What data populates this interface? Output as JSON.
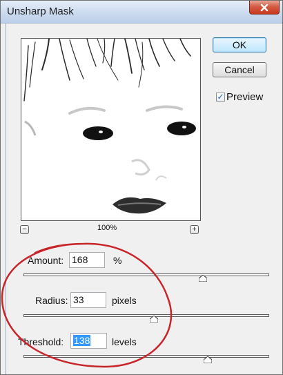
{
  "window": {
    "title": "Unsharp Mask",
    "close_glyph": "X"
  },
  "buttons": {
    "ok_label": "OK",
    "cancel_label": "Cancel"
  },
  "preview": {
    "checkbox_label": "Preview",
    "checked": true,
    "check_glyph": "✓",
    "zoom_level": "100%",
    "zoom_out_glyph": "−",
    "zoom_in_glyph": "+"
  },
  "amount": {
    "label": "Amount:",
    "value": "168",
    "unit": "%",
    "slider_level": 0.73
  },
  "radius": {
    "label": "Radius:",
    "value": "33",
    "unit": "pixels",
    "slider_level": 0.53
  },
  "threshold": {
    "label": "Threshold:",
    "value": "138",
    "unit": "levels",
    "slider_level": 0.75
  },
  "colors": {
    "annotation_circle": "#c8252a",
    "selection": "#3399ff"
  }
}
